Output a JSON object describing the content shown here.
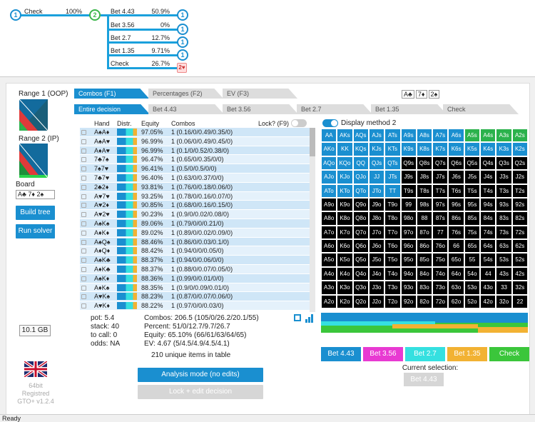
{
  "tree": {
    "root_node": "1",
    "root_label": "Check",
    "root_pct": "100%",
    "mid_node": "2",
    "branches": [
      {
        "label": "Bet 4.43",
        "pct": "50.9%",
        "node": "1"
      },
      {
        "label": "Bet 3.56",
        "pct": "0%",
        "node": "1"
      },
      {
        "label": "Bet 2.7",
        "pct": "12.7%",
        "node": "1"
      },
      {
        "label": "Bet 1.35",
        "pct": "9.71%",
        "node": "1"
      },
      {
        "label": "Check",
        "pct": "26.7%",
        "node": "2♥"
      }
    ]
  },
  "left": {
    "range1": "Range 1 (OOP)",
    "range2": "Range 2 (IP)",
    "board_label": "Board",
    "board_value": "A♣ 7♦ 2♠",
    "build_tree": "Build tree",
    "run_solver": "Run solver",
    "memory": "10.1 GB",
    "build_info": [
      "64bit",
      "Registred",
      "GTO+ v1.2.4"
    ]
  },
  "tabs_top": [
    "Combos (F1)",
    "Percentages (F2)",
    "EV (F3)"
  ],
  "board_cards": [
    "A♣",
    "7♦",
    "2♠"
  ],
  "tabs_second": [
    "Entire decision",
    "Bet 4.43",
    "Bet 3.56",
    "Bet 2.7",
    "Bet 1.35",
    "Check"
  ],
  "table": {
    "headers": [
      "Hand",
      "Distr.",
      "Equity",
      "Combos"
    ],
    "lock_label": "Lock? (F9)",
    "rows": [
      {
        "hand": "A♠A♦",
        "eq": "97.05%",
        "combos": "1 (0.16/0/0.49/0.35/0)"
      },
      {
        "hand": "A♠A♥",
        "eq": "96.99%",
        "combos": "1 (0.06/0/0.49/0.45/0)"
      },
      {
        "hand": "A♦A♥",
        "eq": "96.99%",
        "combos": "1 (0.1/0/0.52/0.38/0)"
      },
      {
        "hand": "7♣7♠",
        "eq": "96.47%",
        "combos": "1 (0.65/0/0.35/0/0)"
      },
      {
        "hand": "7♠7♥",
        "eq": "96.41%",
        "combos": "1 (0.5/0/0.5/0/0)"
      },
      {
        "hand": "7♣7♥",
        "eq": "96.40%",
        "combos": "1 (0.63/0/0.37/0/0)"
      },
      {
        "hand": "2♣2♦",
        "eq": "93.81%",
        "combos": "1 (0.76/0/0.18/0.06/0)"
      },
      {
        "hand": "A♥7♥",
        "eq": "93.25%",
        "combos": "1 (0.78/0/0.16/0.07/0)"
      },
      {
        "hand": "A♥2♦",
        "eq": "90.85%",
        "combos": "1 (0.68/0/0.16/0.15/0)"
      },
      {
        "hand": "A♥2♥",
        "eq": "90.23%",
        "combos": "1 (0.9/0/0.02/0.08/0)"
      },
      {
        "hand": "A♠K♠",
        "eq": "89.06%",
        "combos": "1 (0.79/0/0/0.21/0)"
      },
      {
        "hand": "A♦K♦",
        "eq": "89.02%",
        "combos": "1 (0.89/0/0.02/0.09/0)"
      },
      {
        "hand": "A♠Q♠",
        "eq": "88.46%",
        "combos": "1 (0.86/0/0.03/0.1/0)"
      },
      {
        "hand": "A♦Q♦",
        "eq": "88.42%",
        "combos": "1 (0.94/0/0/0.05/0)"
      },
      {
        "hand": "A♠K♣",
        "eq": "88.37%",
        "combos": "1 (0.94/0/0.06/0/0)"
      },
      {
        "hand": "A♦K♣",
        "eq": "88.37%",
        "combos": "1 (0.88/0/0.07/0.05/0)"
      },
      {
        "hand": "A♠K♦",
        "eq": "88.36%",
        "combos": "1 (0.99/0/0.01/0/0)"
      },
      {
        "hand": "A♦K♠",
        "eq": "88.35%",
        "combos": "1 (0.9/0/0.09/0.01/0)"
      },
      {
        "hand": "A♥K♠",
        "eq": "88.23%",
        "combos": "1 (0.87/0/0.07/0.06/0)"
      },
      {
        "hand": "A♥K♦",
        "eq": "88.22%",
        "combos": "1 (0.97/0/0/0.03/0)"
      }
    ]
  },
  "summary": {
    "pot": "pot: 5.4",
    "stack": "stack: 40",
    "to_call": "to call: 0",
    "odds": "odds: NA",
    "combos": "Combos: 206.5 (105/0/26.2/20.1/55)",
    "percent": "Percent: 51/0/12.7/9.7/26.7",
    "equity": "Equity: 65.10% (66/61/63/64/65)",
    "ev": "EV: 4.67 (5/4.5/4.9/4.5/4.1)",
    "unique": "210 unique items in table"
  },
  "display_method": "Display method 2",
  "grid": {
    "ranks": [
      "A",
      "K",
      "Q",
      "J",
      "T",
      "9",
      "8",
      "7",
      "6",
      "5",
      "4",
      "3",
      "2"
    ]
  },
  "actions": [
    {
      "label": "Bet 4.43",
      "color": "#1a8fd0"
    },
    {
      "label": "Bet 3.56",
      "color": "#e83ad2"
    },
    {
      "label": "Bet 2.7",
      "color": "#35e0e0"
    },
    {
      "label": "Bet 1.35",
      "color": "#f2b233"
    },
    {
      "label": "Check",
      "color": "#3bc63b"
    }
  ],
  "current_selection_label": "Current selection:",
  "current_selection_value": "Bet 4.43",
  "analysis_mode": "Analysis mode (no edits)",
  "lock_edit": "Lock + edit decision",
  "status": "Ready"
}
